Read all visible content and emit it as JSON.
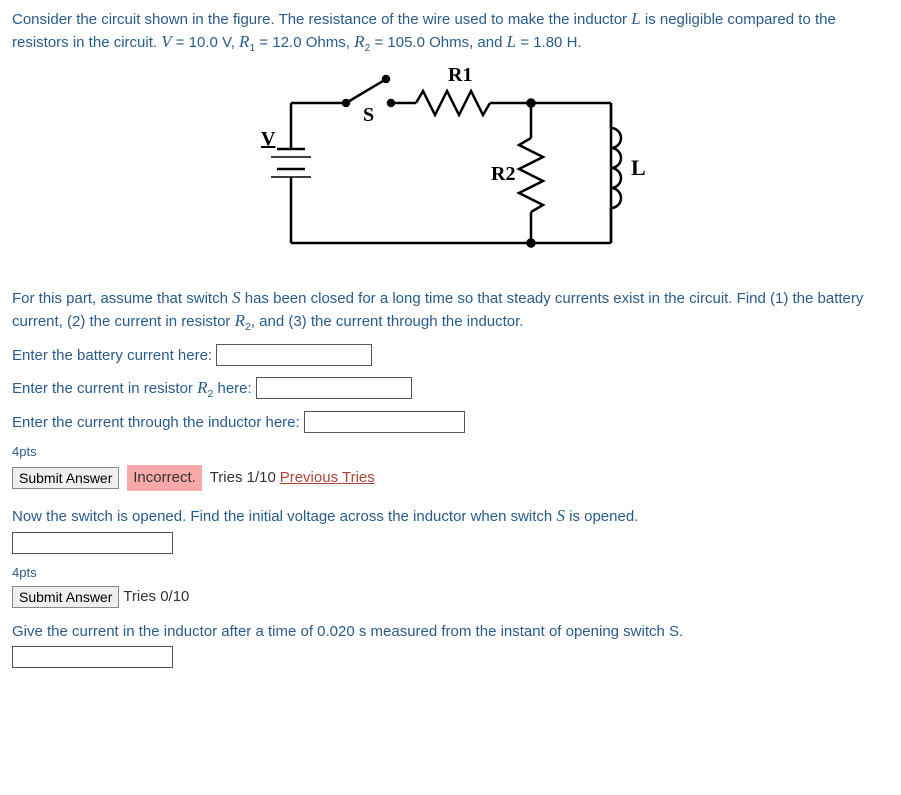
{
  "intro": "Consider the circuit shown in the figure. The resistance of the wire used to make the inductor L is negligible compared to the resistors in the circuit. V = 10.0 V, R₁ = 12.0 Ohms, R₂ = 105.0 Ohms, and L = 1.80 H.",
  "diagram_labels": {
    "R1": "R1",
    "R2": "R2",
    "L": "L",
    "V": "V",
    "S": "S"
  },
  "part1": {
    "instruction": "For this part, assume that switch S has been closed for a long time so that steady currents exist in the circuit. Find (1) the battery current, (2) the current in resistor R₂, and (3) the current through the inductor.",
    "q1_label": "Enter the battery current here:",
    "q2_label_pre": "Enter the current in resistor ",
    "q2_label_post": " here:",
    "q3_label": "Enter the current through the inductor here:",
    "points": "4pts",
    "submit": "Submit Answer",
    "feedback": "Incorrect.",
    "tries": "Tries 1/10",
    "prev": "Previous Tries"
  },
  "part2": {
    "instruction": "Now the switch is opened. Find the initial voltage across the inductor when switch S is opened.",
    "points": "4pts",
    "submit": "Submit Answer",
    "tries": "Tries 0/10"
  },
  "part3": {
    "instruction": "Give the current in the inductor after a time of 0.020 s measured from the instant of opening switch S."
  }
}
